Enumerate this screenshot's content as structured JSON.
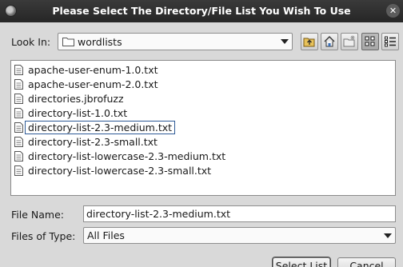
{
  "window": {
    "title": "Please Select The Directory/File List You Wish To Use",
    "close_glyph": "✕"
  },
  "look_in": {
    "label": "Look In:",
    "value": "wordlists",
    "icon": "folder-icon"
  },
  "toolbar": {
    "buttons": [
      {
        "name": "up-one-level-icon"
      },
      {
        "name": "home-icon"
      },
      {
        "name": "new-folder-icon"
      },
      {
        "name": "list-view-icon",
        "active": true
      },
      {
        "name": "details-view-icon"
      }
    ]
  },
  "files": [
    {
      "name": "apache-user-enum-1.0.txt",
      "selected": false
    },
    {
      "name": "apache-user-enum-2.0.txt",
      "selected": false
    },
    {
      "name": "directories.jbrofuzz",
      "selected": false
    },
    {
      "name": "directory-list-1.0.txt",
      "selected": false
    },
    {
      "name": "directory-list-2.3-medium.txt",
      "selected": true
    },
    {
      "name": "directory-list-2.3-small.txt",
      "selected": false
    },
    {
      "name": "directory-list-lowercase-2.3-medium.txt",
      "selected": false
    },
    {
      "name": "directory-list-lowercase-2.3-small.txt",
      "selected": false
    }
  ],
  "file_name": {
    "label": "File Name:",
    "value": "directory-list-2.3-medium.txt"
  },
  "files_of_type": {
    "label": "Files of Type:",
    "value": "All Files"
  },
  "actions": {
    "select_label": "Select List",
    "cancel_label": "Cancel"
  }
}
